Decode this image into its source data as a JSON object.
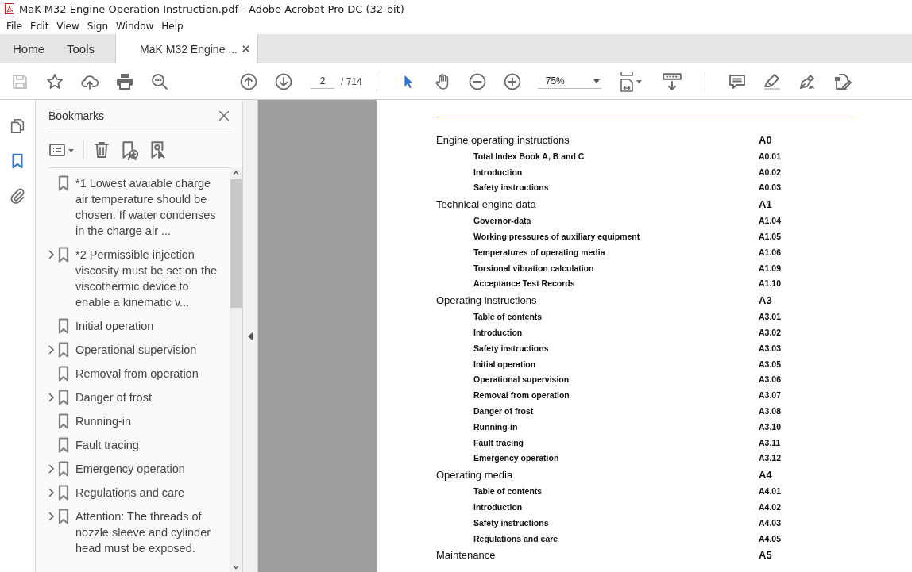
{
  "window": {
    "title": "MaK M32 Engine Operation Instruction.pdf - Adobe Acrobat Pro DC (32-bit)"
  },
  "menu": [
    "File",
    "Edit",
    "View",
    "Sign",
    "Window",
    "Help"
  ],
  "tabs": [
    {
      "label": "Home",
      "selected": false,
      "closable": false
    },
    {
      "label": "Tools",
      "selected": false,
      "closable": false
    },
    {
      "label": "MaK M32 Engine ...",
      "selected": true,
      "closable": true
    }
  ],
  "toolbar": {
    "save_disabled": true,
    "page": "2",
    "page_total": "/ 714",
    "zoom": "75%",
    "tools": [
      {
        "kind": "select",
        "selected": true
      },
      {
        "kind": "hand",
        "selected": false
      }
    ]
  },
  "side_rail": [
    {
      "kind": "pages",
      "selected": false
    },
    {
      "kind": "bookmarks",
      "selected": true
    },
    {
      "kind": "attachments",
      "selected": false
    }
  ],
  "bookmarks": {
    "title": "Bookmarks",
    "items": [
      {
        "label": "*1 Lowest avaiable charge air temperature should be chosen. If water condenses in the charge air ...",
        "expandable": false
      },
      {
        "label": "*2 Permissible injection viscosity must be set on the viscothermic device to enable a kinematic v...",
        "expandable": true
      },
      {
        "label": "Initial operation",
        "expandable": false
      },
      {
        "label": "Operational supervision",
        "expandable": true
      },
      {
        "label": "Removal from operation",
        "expandable": false
      },
      {
        "label": "Danger of frost",
        "expandable": true
      },
      {
        "label": "Running-in",
        "expandable": false
      },
      {
        "label": "Fault tracing",
        "expandable": false
      },
      {
        "label": "Emergency operation",
        "expandable": true
      },
      {
        "label": "Regulations and care",
        "expandable": true
      },
      {
        "label": "Attention: The threads of nozzle sleeve and cylinder head must be exposed.",
        "expandable": true
      }
    ]
  },
  "document": {
    "sections": [
      {
        "title": "Engine operating instructions",
        "code": "A0",
        "entries": [
          {
            "title": "Total Index Book A, B and C",
            "code": "A0.01"
          },
          {
            "title": "Introduction",
            "code": "A0.02"
          },
          {
            "title": "Safety instructions",
            "code": "A0.03"
          }
        ]
      },
      {
        "title": "Technical engine data",
        "code": "A1",
        "entries": [
          {
            "title": "Governor-data",
            "code": "A1.04"
          },
          {
            "title": "Working pressures of auxiliary equipment",
            "code": "A1.05"
          },
          {
            "title": "Temperatures of operating media",
            "code": "A1.06"
          },
          {
            "title": "Torsional vibration calculation",
            "code": "A1.09"
          },
          {
            "title": "Acceptance Test Records",
            "code": "A1.10"
          }
        ]
      },
      {
        "title": "Operating instructions",
        "code": "A3",
        "entries": [
          {
            "title": "Table of contents",
            "code": "A3.01"
          },
          {
            "title": "Introduction",
            "code": "A3.02"
          },
          {
            "title": "Safety instructions",
            "code": "A3.03"
          },
          {
            "title": "Initial operation",
            "code": "A3.05"
          },
          {
            "title": "Operational supervision",
            "code": "A3.06"
          },
          {
            "title": "Removal from operation",
            "code": "A3.07"
          },
          {
            "title": "Danger of frost",
            "code": "A3.08"
          },
          {
            "title": "Running-in",
            "code": "A3.10"
          },
          {
            "title": "Fault tracing",
            "code": "A3.11"
          },
          {
            "title": "Emergency operation",
            "code": "A3.12"
          }
        ]
      },
      {
        "title": "Operating media",
        "code": "A4",
        "entries": [
          {
            "title": "Table of contents",
            "code": "A4.01"
          },
          {
            "title": "Introduction",
            "code": "A4.02"
          },
          {
            "title": "Safety instructions",
            "code": "A4.03"
          },
          {
            "title": "Regulations and care",
            "code": "A4.05"
          }
        ]
      },
      {
        "title": "Maintenance",
        "code": "A5"
      }
    ]
  }
}
